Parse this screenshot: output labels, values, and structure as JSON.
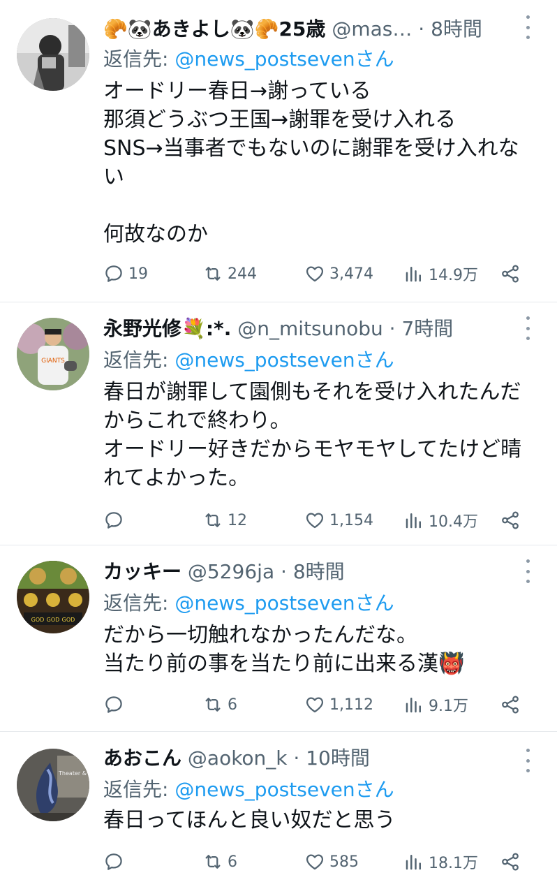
{
  "tweets": [
    {
      "name": "🥐🐼あきよし🐼🥐25歳",
      "handle": "@mas…",
      "sep": " · ",
      "time": "8時間",
      "reply_prefix": "返信先: ",
      "reply_to": "@news_postsevenさん",
      "text": "オードリー春日→謝っている\n那須どうぶつ王国→謝罪を受け入れる\nSNS→当事者でもないのに謝罪を受け入れない\n\n何故なのか",
      "replies": "19",
      "retweets": "244",
      "likes": "3,474",
      "views": "14.9万"
    },
    {
      "name": "永野光修💐:*.",
      "handle": "@n_mitsunobu",
      "sep": " · ",
      "time": "7時間",
      "reply_prefix": "返信先: ",
      "reply_to": "@news_postsevenさん",
      "text": "春日が謝罪して園側もそれを受け入れたんだからこれで終わり。\nオードリー好きだからモヤモヤしてたけど晴れてよかった。",
      "replies": "",
      "retweets": "12",
      "likes": "1,154",
      "views": "10.4万"
    },
    {
      "name": "カッキー",
      "handle": "@5296ja",
      "sep": " · ",
      "time": "8時間",
      "reply_prefix": "返信先: ",
      "reply_to": "@news_postsevenさん",
      "text": "だから一切触れなかったんだな。\n当たり前の事を当たり前に出来る漢👹",
      "replies": "",
      "retweets": "6",
      "likes": "1,112",
      "views": "9.1万"
    },
    {
      "name": "あおこん",
      "handle": "@aokon_k",
      "sep": " · ",
      "time": "10時間",
      "reply_prefix": "返信先: ",
      "reply_to": "@news_postsevenさん",
      "text": "春日ってほんと良い奴だと思う",
      "replies": "",
      "retweets": "6",
      "likes": "585",
      "views": "18.1万"
    }
  ],
  "icons": {
    "reply": "speech-bubble-icon",
    "retweet": "retweet-arrows-icon",
    "like": "heart-icon",
    "views": "bar-chart-icon",
    "share": "share-nodes-icon",
    "more": "vertical-dots-icon"
  },
  "colors": {
    "link": "#1d9bf0",
    "muted": "#536471",
    "text": "#0f1419"
  }
}
